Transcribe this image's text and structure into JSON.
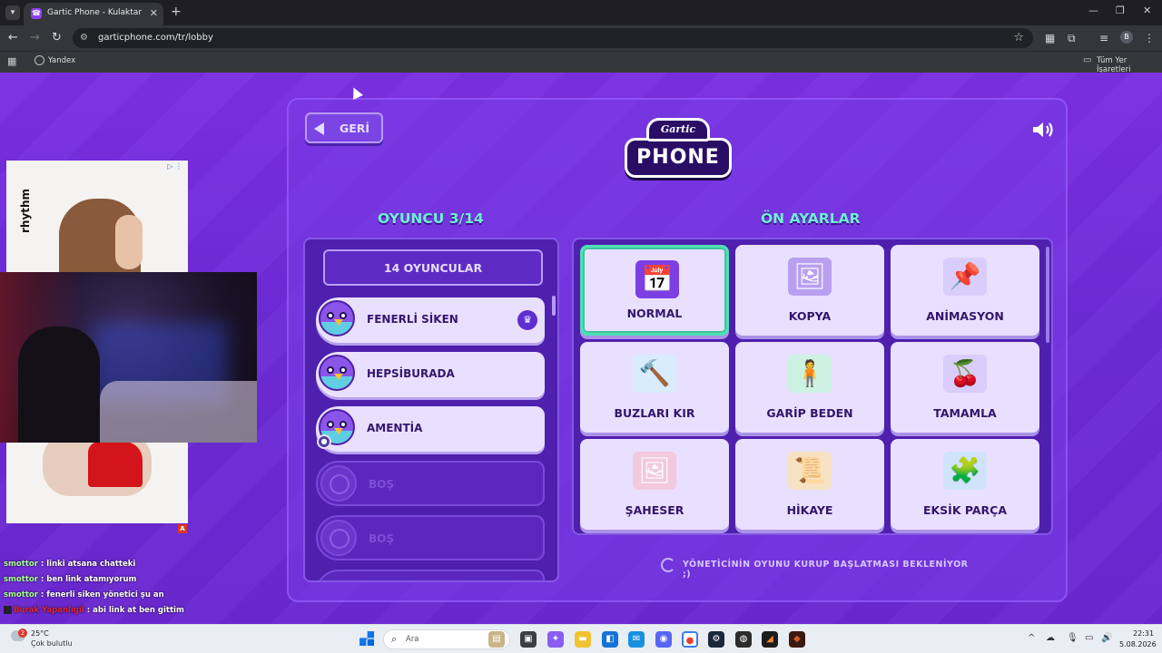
{
  "browser": {
    "tab_title": "Gartic Phone - Kulaktan Kulağa",
    "url": "garticphone.com/tr/lobby",
    "bookmarks": {
      "yandex": "Yandex",
      "all_bookmarks": "Tüm Yer İşaretleri"
    },
    "profile_initial": "B"
  },
  "game": {
    "back_label": "GERİ",
    "logo_top": "Gartic",
    "logo_main": "PHONE",
    "players_title": "OYUNCU 3/14",
    "presets_title": "ÖN AYARLAR",
    "players_count_label": "14 OYUNCULAR",
    "players": [
      {
        "name": "FENERLİ SİKEN",
        "state": "filled",
        "badge": "crown"
      },
      {
        "name": "HEPSİBURADA",
        "state": "filled"
      },
      {
        "name": "AMENTİA",
        "state": "filled",
        "badge": "user"
      },
      {
        "name": "BOŞ",
        "state": "empty"
      },
      {
        "name": "BOŞ",
        "state": "empty"
      }
    ],
    "presets": [
      {
        "label": "NORMAL",
        "icon": "calendar-pencil-icon",
        "selected": true
      },
      {
        "label": "KOPYA",
        "icon": "copy-cards-icon"
      },
      {
        "label": "ANİMASYON",
        "icon": "animation-pin-icon"
      },
      {
        "label": "BUZLARI KIR",
        "icon": "ice-hammer-icon"
      },
      {
        "label": "GARİP BEDEN",
        "icon": "weird-body-icon"
      },
      {
        "label": "TAMAMLA",
        "icon": "complete-puzzle-icon"
      },
      {
        "label": "ŞAHESER",
        "icon": "masterpiece-icon"
      },
      {
        "label": "HİKAYE",
        "icon": "story-scroll-icon"
      },
      {
        "label": "EKSİK PARÇA",
        "icon": "missing-piece-icon"
      }
    ],
    "waiting_text": "YÖNETİCİNİN OYUNU KURUP BAŞLATMASI BEKLENİYOR ;)"
  },
  "overlay": {
    "ad_brand": "rhythm",
    "ad_badge": "A",
    "chat": [
      {
        "user": "smottor",
        "text": ": linki atsana chatteki"
      },
      {
        "user": "smottor",
        "text": ": ben link atamıyorum"
      },
      {
        "user": "smottor",
        "text": ": fenerli siken yönetici şu an"
      },
      {
        "user": "Burak Yapanlıgil",
        "text": ": abi link at ben gittim"
      }
    ]
  },
  "taskbar": {
    "weather_badge": "2",
    "weather_temp": "25°C",
    "weather_desc": "Çok bulutlu",
    "search_placeholder": "Ara",
    "time": "22:31",
    "date": "5.08.2026"
  }
}
